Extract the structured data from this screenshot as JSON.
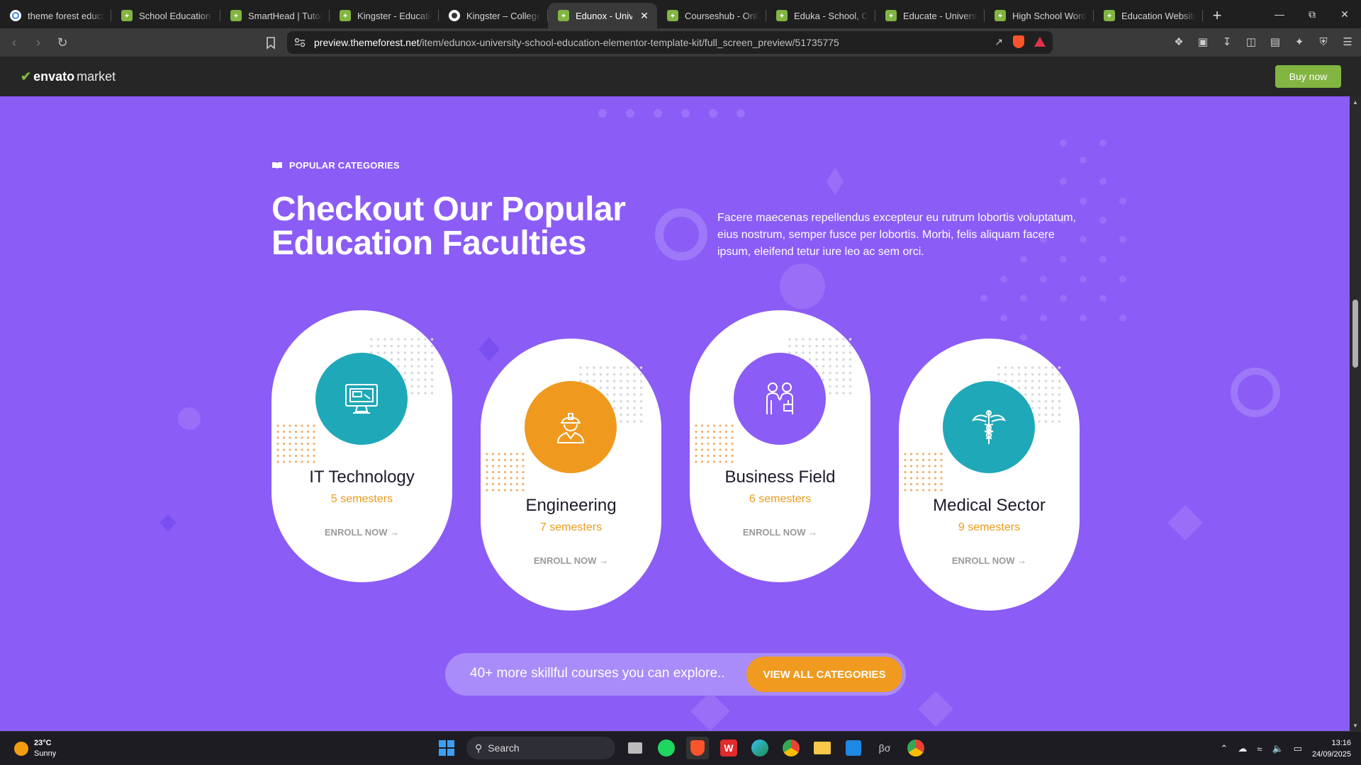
{
  "browser": {
    "tabs": [
      {
        "title": "theme forest educta",
        "favicon": "google-icon"
      },
      {
        "title": "School Education W",
        "favicon": "envato-icon"
      },
      {
        "title": "SmartHead | Tutorin",
        "favicon": "envato-icon"
      },
      {
        "title": "Kingster - Education",
        "favicon": "envato-icon"
      },
      {
        "title": "Kingster – College –",
        "favicon": "kingster-icon"
      },
      {
        "title": "Edunox - Unive",
        "favicon": "envato-icon",
        "active": true
      },
      {
        "title": "Courseshub - Onlin",
        "favicon": "envato-icon"
      },
      {
        "title": "Eduka - School, Coll",
        "favicon": "envato-icon"
      },
      {
        "title": "Educate - University",
        "favicon": "envato-icon"
      },
      {
        "title": "High School WordP",
        "favicon": "envato-icon"
      },
      {
        "title": "Education Website",
        "favicon": "envato-icon"
      }
    ],
    "url_host": "preview.themeforest.net",
    "url_path": "/item/edunox-university-school-education-elementor-template-kit/full_screen_preview/51735775"
  },
  "envato": {
    "logo_brand": "envato",
    "logo_market": "market",
    "buy_label": "Buy now"
  },
  "section": {
    "eyebrow": "POPULAR CATEGORIES",
    "heading_line1": "Checkout Our Popular",
    "heading_line2": "Education Faculties",
    "intro": "Facere maecenas repellendus excepteur eu rutrum lobortis voluptatum, eius nostrum, semper fusce per lobortis. Morbi, felis aliquam facere ipsum, eleifend tetur iure leo ac sem orci."
  },
  "cards": [
    {
      "name": "IT Technology",
      "semesters": "5 semesters",
      "enroll": "ENROLL NOW →",
      "icon": "computer-icon",
      "color": "#1fa8b8"
    },
    {
      "name": "Engineering",
      "semesters": "7 semesters",
      "enroll": "ENROLL NOW →",
      "icon": "engineer-icon",
      "color": "#ef9a1f"
    },
    {
      "name": "Business Field",
      "semesters": "6 semesters",
      "enroll": "ENROLL NOW →",
      "icon": "business-icon",
      "color": "#8b5cf6"
    },
    {
      "name": "Medical Sector",
      "semesters": "9 semesters",
      "enroll": "ENROLL NOW →",
      "icon": "caduceus-icon",
      "color": "#1fa8b8"
    }
  ],
  "cta": {
    "text": "40+ more skillful courses you can explore..",
    "button": "VIEW ALL CATEGORIES"
  },
  "taskbar": {
    "temp": "23°C",
    "weather": "Sunny",
    "search": "Search",
    "time": "13:16",
    "date": "24/09/2025"
  },
  "colors": {
    "page_bg": "#8b5cf6",
    "accent_orange": "#ef9a1f",
    "teal": "#1fa8b8",
    "envato_green": "#82b541"
  }
}
